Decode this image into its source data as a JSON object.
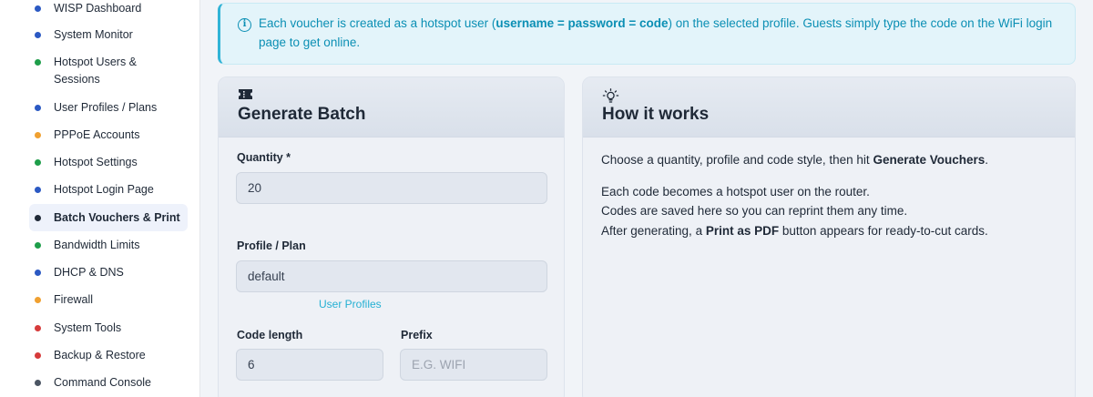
{
  "sidebar": {
    "items": [
      {
        "label": "WISP Dashboard",
        "color": "#2b59c3"
      },
      {
        "label": "System Monitor",
        "color": "#2b59c3"
      },
      {
        "label": "Hotspot Users & Sessions",
        "color": "#1e9e4a"
      },
      {
        "label": "User Profiles / Plans",
        "color": "#2b59c3"
      },
      {
        "label": "PPPoE Accounts",
        "color": "#f0a030"
      },
      {
        "label": "Hotspot Settings",
        "color": "#1e9e4a"
      },
      {
        "label": "Hotspot Login Page",
        "color": "#2b59c3"
      },
      {
        "label": "Batch Vouchers & Print",
        "color": "#1f2937",
        "active": true
      },
      {
        "label": "Bandwidth Limits",
        "color": "#1e9e4a"
      },
      {
        "label": "DHCP & DNS",
        "color": "#2b59c3"
      },
      {
        "label": "Firewall",
        "color": "#f0a030"
      },
      {
        "label": "System Tools",
        "color": "#d63b3b"
      },
      {
        "label": "Backup & Restore",
        "color": "#d63b3b"
      },
      {
        "label": "Command Console",
        "color": "#4b5563"
      }
    ]
  },
  "alert": {
    "text_1": "Each voucher is created as a hotspot user (",
    "bold": "username = password = code",
    "text_2": ") on the selected profile. Guests simply type the code on the WiFi login page to get online."
  },
  "generate": {
    "title": "Generate Batch",
    "quantity_label": "Quantity *",
    "quantity_value": "20",
    "profile_label": "Profile / Plan",
    "profile_value": "default",
    "profiles_link": "User Profiles",
    "code_length_label": "Code length",
    "code_length_value": "6",
    "prefix_label": "Prefix",
    "prefix_placeholder": "E.G. WIFI"
  },
  "how": {
    "title": "How it works",
    "p1_text": "Choose a quantity, profile and code style, then hit ",
    "p1_bold": "Generate Vouchers",
    "p1_end": ".",
    "p2_line1": "Each code becomes a hotspot user on the router.",
    "p2_line2": "Codes are saved here so you can reprint them any time.",
    "p2_line3_a": "After generating, a ",
    "p2_line3_bold": "Print as PDF",
    "p2_line3_b": " button appears for ready-to-cut cards."
  }
}
